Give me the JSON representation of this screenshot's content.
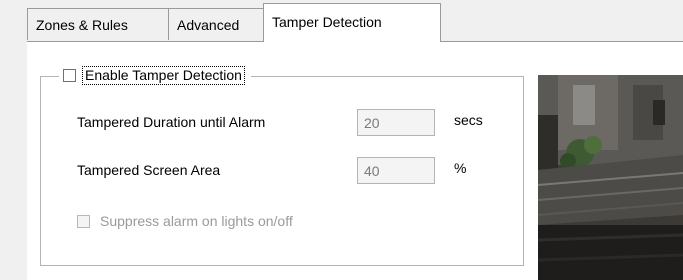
{
  "tabs": [
    {
      "label": "Zones & Rules"
    },
    {
      "label": "Advanced"
    },
    {
      "label": "Tamper Detection"
    }
  ],
  "tamper": {
    "enable_label": "Enable Tamper Detection",
    "enable_checked": false,
    "duration_label": "Tampered Duration until Alarm",
    "duration_value": "20",
    "duration_unit": "secs",
    "area_label": "Tampered Screen Area",
    "area_value": "40",
    "area_unit": "%",
    "suppress_label": "Suppress alarm on lights on/off",
    "suppress_checked": false
  },
  "icons": {
    "checkbox": "checkbox-icon"
  }
}
